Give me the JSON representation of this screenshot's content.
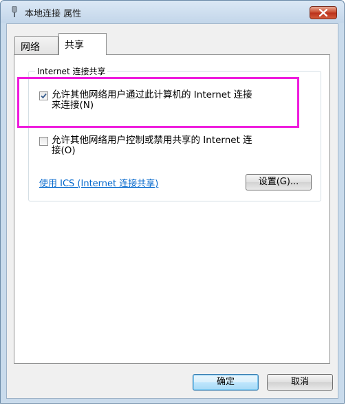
{
  "window": {
    "title": "本地连接 属性"
  },
  "tabs": [
    {
      "label": "网络",
      "selected": false
    },
    {
      "label": "共享",
      "selected": true
    }
  ],
  "sharing": {
    "group_label": "Internet 连接共享",
    "allow_connect": {
      "line1": "允许其他网络用户通过此计算机的 Internet 连接",
      "line2": "来连接(N)",
      "checked": true
    },
    "allow_control": {
      "line1": "允许其他网络用户控制或禁用共享的 Internet 连",
      "line2": "接(O)",
      "checked": false
    },
    "ics_link": "使用 ICS (Internet 连接共享)",
    "settings_button": "设置(G)..."
  },
  "footer": {
    "ok_button": "确定",
    "cancel_button": "取消"
  },
  "colors": {
    "highlight": "#ee1cdd",
    "link": "#0066cc"
  }
}
